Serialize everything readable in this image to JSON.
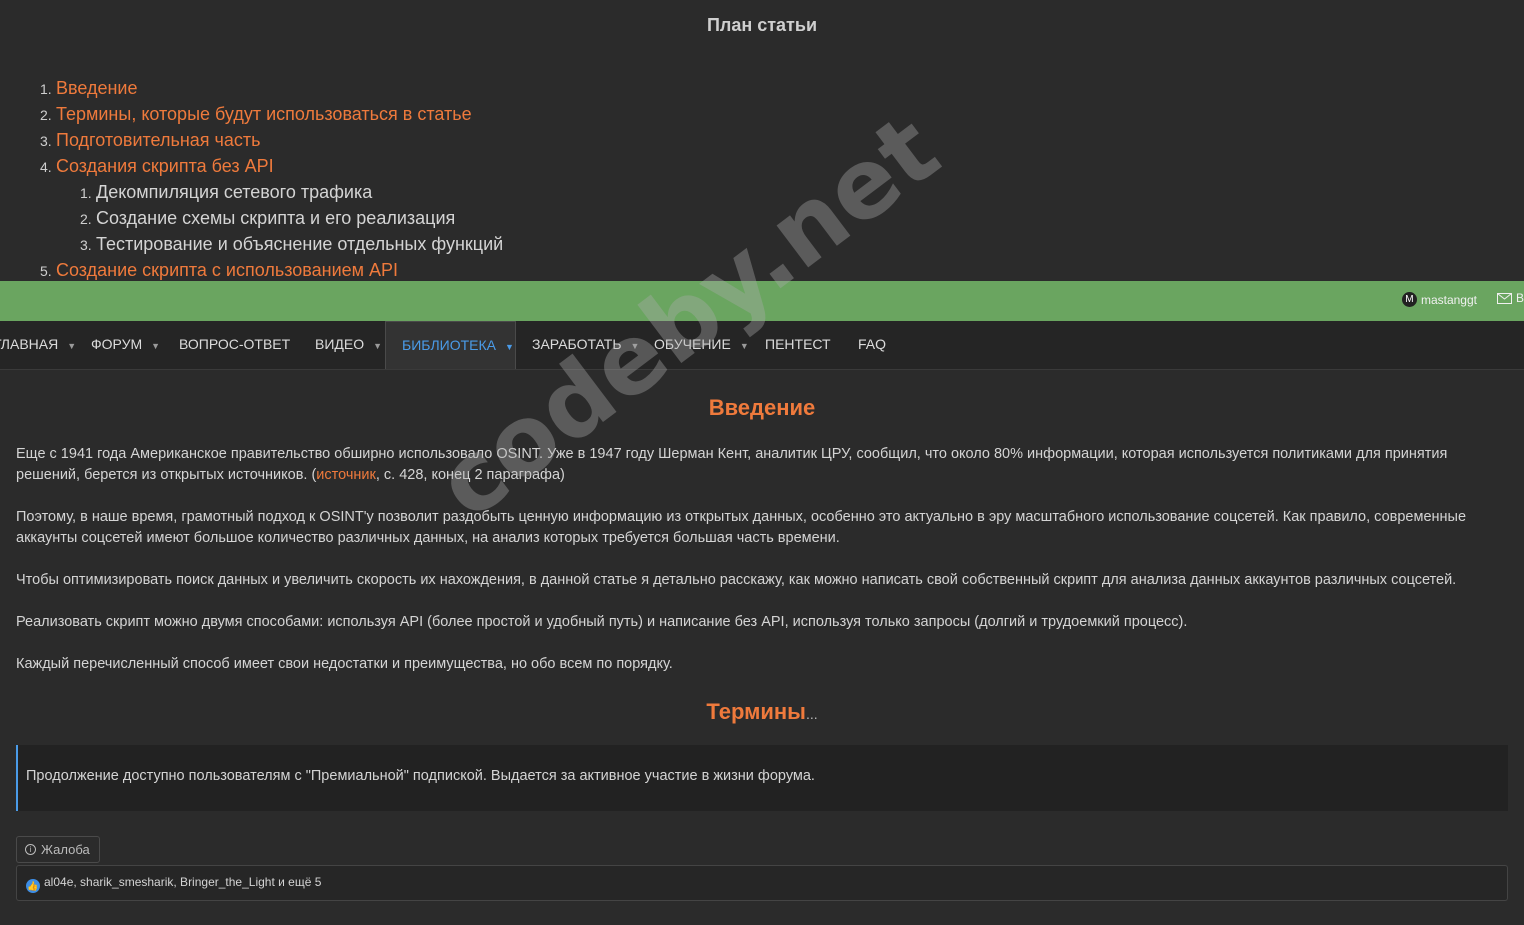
{
  "plan": {
    "title": "План статьи",
    "items": [
      {
        "num": "1.",
        "label": "Введение"
      },
      {
        "num": "2.",
        "label": "Термины, которые будут использоваться в статье"
      },
      {
        "num": "3.",
        "label": "Подготовительная часть"
      },
      {
        "num": "4.",
        "label": "Создания скрипта без API"
      },
      {
        "num": "5.",
        "label": "Создание скрипта с использованием API"
      }
    ],
    "subitems": [
      {
        "num": "1.",
        "label": "Декомпиляция сетевого трафика"
      },
      {
        "num": "2.",
        "label": "Создание схемы скрипта и его реализация"
      },
      {
        "num": "3.",
        "label": "Тестирование и объяснение отдельных функций"
      }
    ]
  },
  "topbar": {
    "username": "mastanggt",
    "avatar_letter": "M",
    "mail_label": "В"
  },
  "nav": {
    "items": [
      {
        "label": "ГЛАВНАЯ"
      },
      {
        "label": "ФОРУМ"
      },
      {
        "label": "ВОПРОС-ОТВЕТ"
      },
      {
        "label": "ВИДЕО"
      },
      {
        "label": "БИБЛИОТЕКА"
      },
      {
        "label": "ЗАРАБОТАТЬ"
      },
      {
        "label": "ОБУЧЕНИЕ"
      },
      {
        "label": "ПЕНТЕСТ"
      },
      {
        "label": "FAQ"
      }
    ],
    "active": "БИБЛИОТЕКА"
  },
  "content": {
    "intro_heading": "Введение",
    "p1_before": "Еще с 1941 года Американское правительство обширно использовало OSINT. Уже в 1947 году Шерман Кент, аналитик ЦРУ, сообщил, что около 80% информации, которая используется политиками для принятия решений, берется из открытых источников. (",
    "p1_link": "источник",
    "p1_after": ", с. 428, конец 2 параграфа)",
    "p2": "Поэтому, в наше время, грамотный подход к OSINT'у позволит раздобыть ценную информацию из открытых данных, особенно это актуально в эру масштабного использование соцсетей. Как правило, современные аккаунты соцсетей имеют большое количество различных данных, на анализ которых требуется большая часть времени.",
    "p3": "Чтобы оптимизировать поиск данных и увеличить скорость их нахождения, в данной статье я детально расскажу, как можно написать свой собственный скрипт для анализа данных аккаунтов различных соцсетей.",
    "p4": "Реализовать скрипт можно двумя способами: используя API (более простой и удобный путь) и написание без API, используя только запросы (долгий и трудоемкий процесс).",
    "p5": "Каждый перечисленный способ имеет свои недостатки и преимущества, но обо всем по порядку.",
    "terms_heading": "Термины",
    "terms_ellipsis": "...",
    "notice": "Продолжение доступно пользователям с \"Премиальной\" подпиской. Выдается за активное участие в жизни форума.",
    "report_label": "Жалоба",
    "reactions_text": "al04e, sharik_smesharik, Bringer_the_Light и ещё 5"
  },
  "watermark": "codeby.net",
  "colors": {
    "accent_orange": "#ef7a3c",
    "green_bar": "#6aa560",
    "active_blue": "#4a9be8",
    "background": "#2b2b2b"
  }
}
